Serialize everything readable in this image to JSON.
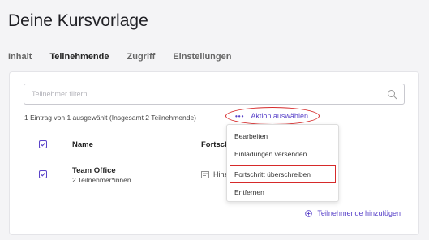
{
  "page_title": "Deine Kursvorlage",
  "tabs": [
    {
      "label": "Inhalt",
      "active": false
    },
    {
      "label": "Teilnehmende",
      "active": true
    },
    {
      "label": "Zugriff",
      "active": false
    },
    {
      "label": "Einstellungen",
      "active": false
    }
  ],
  "search": {
    "placeholder": "Teilnehmer filtern",
    "value": ""
  },
  "selection": {
    "summary": "1 Eintrag von 1 ausgewählt (Insgesamt 2 Teilnehmende)",
    "action_label": "Aktion auswählen"
  },
  "table": {
    "headers": {
      "name": "Name",
      "progress": "Fortschritt"
    },
    "rows": [
      {
        "name": "Team Office",
        "sub": "2 Teilnehmer*innen",
        "progress": "Hinzu",
        "checked": true
      }
    ]
  },
  "dropdown": {
    "items": [
      "Bearbeiten",
      "Einladungen versenden",
      "Fortschritt überschreiben",
      "Entfernen"
    ],
    "highlighted": "Fortschritt überschreiben"
  },
  "add_participants_label": "Teilnehmende hinzufügen",
  "colors": {
    "accent": "#5a43c9",
    "highlight": "#d62a2a"
  }
}
